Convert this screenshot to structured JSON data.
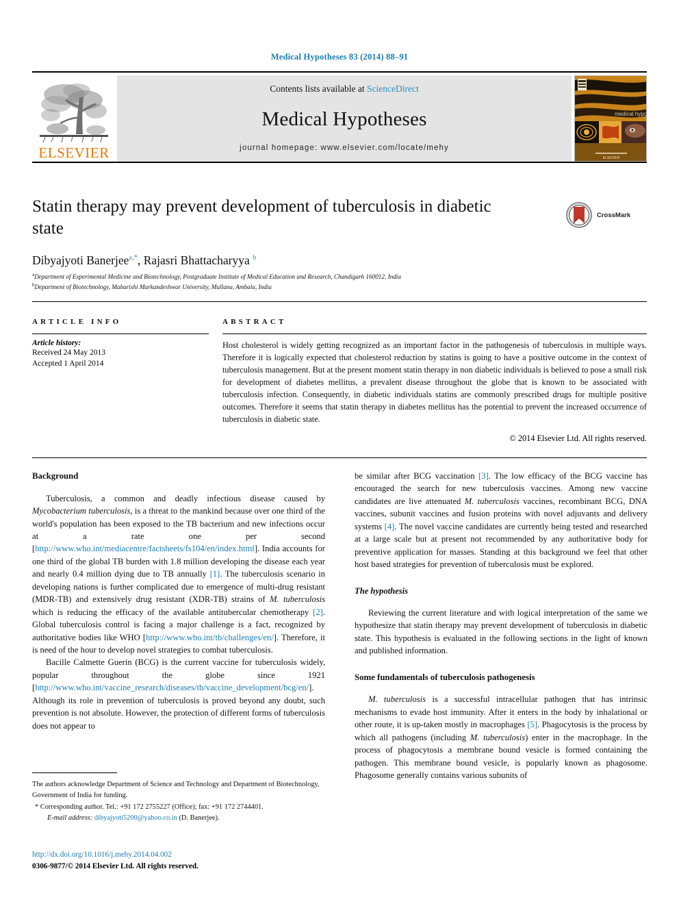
{
  "running_head": "Medical Hypotheses 83 (2014) 88–91",
  "masthead": {
    "contents_prefix": "Contents lists available at ",
    "sciencedirect": "ScienceDirect",
    "journal_name": "Medical Hypotheses",
    "homepage": "journal homepage: www.elsevier.com/locate/mehy",
    "publisher_word": "ELSEVIER",
    "cover_caption": "medical hypotheses"
  },
  "article": {
    "title": "Statin therapy may prevent development of tuberculosis in diabetic state",
    "crossmark_label": "CrossMark",
    "authors_html": "Dibyajyoti Banerjee<sup>a,*</sup>, Rajasri Bhattacharyya <sup>b</sup>",
    "affiliation_a": "Department of Experimental Medicine and Biotechnology, Postgraduate Institute of Medical Education and Research, Chandigarh 160012, India",
    "affiliation_b": "Department of Biotechnology, Maharishi Markandeshwar University, Mullana, Ambala, India"
  },
  "article_info": {
    "heading": "ARTICLE INFO",
    "history_label": "Article history:",
    "received": "Received 24 May 2013",
    "accepted": "Accepted 1 April 2014"
  },
  "abstract": {
    "heading": "ABSTRACT",
    "text": "Host cholesterol is widely getting recognized as an important factor in the pathogenesis of tuberculosis in multiple ways. Therefore it is logically expected that cholesterol reduction by statins is going to have a positive outcome in the context of tuberculosis management. But at the present moment statin therapy in non diabetic individuals is believed to pose a small risk for development of diabetes mellitus, a prevalent disease throughout the globe that is known to be associated with tuberculosis infection. Consequently, in diabetic individuals statins are commonly prescribed drugs for multiple positive outcomes. Therefore it seems that statin therapy in diabetes mellitus has the potential to prevent the increased occurrence of tuberculosis in diabetic state.",
    "copyright": "© 2014 Elsevier Ltd. All rights reserved."
  },
  "body": {
    "background_heading": "Background",
    "p1_a": "Tuberculosis, a common and deadly infectious disease caused by ",
    "p1_italic1": "Mycobacterium tuberculosis",
    "p1_b": ", is a threat to the mankind because over one third of the world's population has been exposed to the TB bacterium and new infections occur at a rate one per second [",
    "p1_link1": "http://www.who.int/mediacentre/factsheets/fs104/en/index.html",
    "p1_c": "]. India accounts for one third of the global TB burden with 1.8 million developing the disease each year and nearly 0.4 million dying due to TB annually ",
    "p1_ref1": "[1]",
    "p1_d": ". The tuberculosis scenario in developing nations is further complicated due to emergence of multi-drug resistant (MDR-TB) and extensively drug resistant (XDR-TB) strains of ",
    "p1_italic2": "M. tuberculosis",
    "p1_e": " which is reducing the efficacy of the available antitubercular chemotherapy ",
    "p1_ref2": "[2]",
    "p1_f": ". Global tuberculosis control is facing a major challenge is a fact, recognized by authoritative bodies like WHO [",
    "p1_link2": "http://www.who.int/tb/challenges/en/",
    "p1_g": "]. Therefore, it is need of the hour to develop novel strategies to combat tuberculosis.",
    "p2_a": "Bacille Calmette Guerin (BCG) is the current vaccine for tuberculosis widely, popular throughout the globe since 1921 [",
    "p2_link": "http://www.who.int/vaccine_research/diseases/tb/vaccine_development/bcg/en/",
    "p2_b": "]. Although its role in prevention of tuberculosis is proved beyond any doubt, such prevention is not absolute. However, the protection of different forms of tuberculosis does not appear to",
    "p3_a": "be similar after BCG vaccination ",
    "p3_ref1": "[3]",
    "p3_b": ". The low efficacy of the BCG vaccine has encouraged the search for new tuberculosis vaccines. Among new vaccine candidates are live attenuated ",
    "p3_italic1": "M. tuberculosis",
    "p3_c": " vaccines, recombinant BCG, DNA vaccines, subunit vaccines and fusion proteins with novel adjuvants and delivery systems ",
    "p3_ref2": "[4]",
    "p3_d": ". The novel vaccine candidates are currently being tested and researched at a large scale but at present not recommended by any authoritative body for preventive application for masses. Standing at this background we feel that other host based strategies for prevention of tuberculosis must be explored.",
    "hypothesis_heading": "The hypothesis",
    "p4": "Reviewing the current literature and with logical interpretation of the same we hypothesize that statin therapy may prevent development of tuberculosis in diabetic state. This hypothesis is evaluated in the following sections in the light of known and published information.",
    "fundamentals_heading": "Some fundamentals of tuberculosis pathogenesis",
    "p5_italic1": "M. tuberculosis",
    "p5_a": " is a successful intracellular pathogen that has intrinsic mechanisms to evade host immunity. After it enters in the body by inhalational or other route, it is up-taken mostly in macrophages ",
    "p5_ref1": "[5]",
    "p5_b": ". Phagocytosis is the process by which all pathogens (including ",
    "p5_italic2": "M. tuberculosis",
    "p5_c": ") enter in the macrophage. In the process of phagocytosis a membrane bound vesicle is formed containing the pathogen. This membrane bound vesicle, is popularly known as phagosome. Phagosome generally contains various subunits of"
  },
  "footnotes": {
    "funding": "The authors acknowledge Department of Science and Technology and Department of Biotechnology, Government of India for funding.",
    "corresponding": "* Corresponding author. Tel.: +91 172 2755227 (Office); fax: +91 172 2744401.",
    "email_label": "E-mail address:",
    "email": "dibyajyoti5200@yahoo.co.in",
    "email_suffix": " (D. Banerjee)."
  },
  "footer": {
    "doi": "http://dx.doi.org/10.1016/j.mehy.2014.04.002",
    "issn_line": "0306-9877/© 2014 Elsevier Ltd. All rights reserved."
  },
  "colors": {
    "link_blue": "#1a7cb5",
    "sciencedirect_blue": "#2a8fc7",
    "elsevier_orange": "#ee7600",
    "band_gray": "#e4e4e4"
  }
}
